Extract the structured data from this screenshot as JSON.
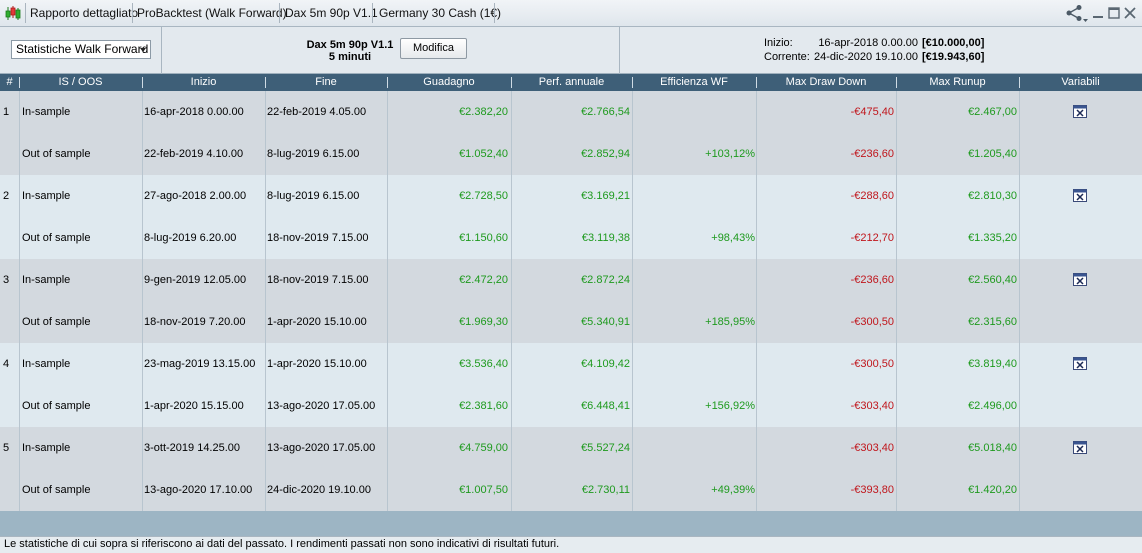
{
  "titlebar": {
    "report": "Rapporto dettagliato",
    "module": "ProBacktest (Walk Forward)",
    "strategy": "Dax 5m 90p V1.1",
    "instrument": "Germany 30 Cash (1€)"
  },
  "controls": {
    "dropdown": "Statistiche Walk Forward",
    "strategy_name": "Dax 5m 90p V1.1",
    "timeframe": "5 minuti",
    "edit_button": "Modifica",
    "start_label": "Inizio:",
    "start_date": "16-apr-2018 0.00.00",
    "start_amount": "[€10.000,00]",
    "end_label": "Corrente:",
    "end_date": "24-dic-2020 19.10.00",
    "end_amount": "[€19.943,60]"
  },
  "table": {
    "headers": [
      "#",
      "IS / OOS",
      "Inizio",
      "Fine",
      "Guadagno",
      "Perf. annuale",
      "Efficienza WF",
      "Max Draw Down",
      "Max Runup",
      "Variabili"
    ],
    "groups": [
      {
        "num": "1",
        "is": {
          "label": "In-sample",
          "start": "16-apr-2018 0.00.00",
          "end": "22-feb-2019 4.05.00",
          "gain": "€2.382,20",
          "annual": "€2.766,54",
          "eff": "",
          "dd": "-€475,40",
          "runup": "€2.467,00"
        },
        "oos": {
          "label": "Out of sample",
          "start": "22-feb-2019 4.10.00",
          "end": "8-lug-2019 6.15.00",
          "gain": "€1.052,40",
          "annual": "€2.852,94",
          "eff": "+103,12%",
          "dd": "-€236,60",
          "runup": "€1.205,40"
        }
      },
      {
        "num": "2",
        "is": {
          "label": "In-sample",
          "start": "27-ago-2018 2.00.00",
          "end": "8-lug-2019 6.15.00",
          "gain": "€2.728,50",
          "annual": "€3.169,21",
          "eff": "",
          "dd": "-€288,60",
          "runup": "€2.810,30"
        },
        "oos": {
          "label": "Out of sample",
          "start": "8-lug-2019 6.20.00",
          "end": "18-nov-2019 7.15.00",
          "gain": "€1.150,60",
          "annual": "€3.119,38",
          "eff": "+98,43%",
          "dd": "-€212,70",
          "runup": "€1.335,20"
        }
      },
      {
        "num": "3",
        "is": {
          "label": "In-sample",
          "start": "9-gen-2019 12.05.00",
          "end": "18-nov-2019 7.15.00",
          "gain": "€2.472,20",
          "annual": "€2.872,24",
          "eff": "",
          "dd": "-€236,60",
          "runup": "€2.560,40"
        },
        "oos": {
          "label": "Out of sample",
          "start": "18-nov-2019 7.20.00",
          "end": "1-apr-2020 15.10.00",
          "gain": "€1.969,30",
          "annual": "€5.340,91",
          "eff": "+185,95%",
          "dd": "-€300,50",
          "runup": "€2.315,60"
        }
      },
      {
        "num": "4",
        "is": {
          "label": "In-sample",
          "start": "23-mag-2019 13.15.00",
          "end": "1-apr-2020 15.10.00",
          "gain": "€3.536,40",
          "annual": "€4.109,42",
          "eff": "",
          "dd": "-€300,50",
          "runup": "€3.819,40"
        },
        "oos": {
          "label": "Out of sample",
          "start": "1-apr-2020 15.15.00",
          "end": "13-ago-2020 17.05.00",
          "gain": "€2.381,60",
          "annual": "€6.448,41",
          "eff": "+156,92%",
          "dd": "-€303,40",
          "runup": "€2.496,00"
        }
      },
      {
        "num": "5",
        "is": {
          "label": "In-sample",
          "start": "3-ott-2019 14.25.00",
          "end": "13-ago-2020 17.05.00",
          "gain": "€4.759,00",
          "annual": "€5.527,24",
          "eff": "",
          "dd": "-€303,40",
          "runup": "€5.018,40"
        },
        "oos": {
          "label": "Out of sample",
          "start": "13-ago-2020 17.10.00",
          "end": "24-dic-2020 19.10.00",
          "gain": "€1.007,50",
          "annual": "€2.730,11",
          "eff": "+49,39%",
          "dd": "-€393,80",
          "runup": "€1.420,20"
        }
      }
    ]
  },
  "footer": "Le statistiche di cui sopra si riferiscono ai dati del passato. I rendimenti passati non sono indicativi di risultati futuri.",
  "colors": {
    "header_bg": "#3e5f78",
    "positive": "#1e9a1e",
    "negative": "#c0161c",
    "row_odd": "#d3d9df",
    "row_even": "#dfe9ef"
  },
  "icons": [
    "candlestick-chart-icon",
    "share-icon",
    "minimize-icon",
    "maximize-icon",
    "close-icon",
    "excel-export-icon"
  ]
}
